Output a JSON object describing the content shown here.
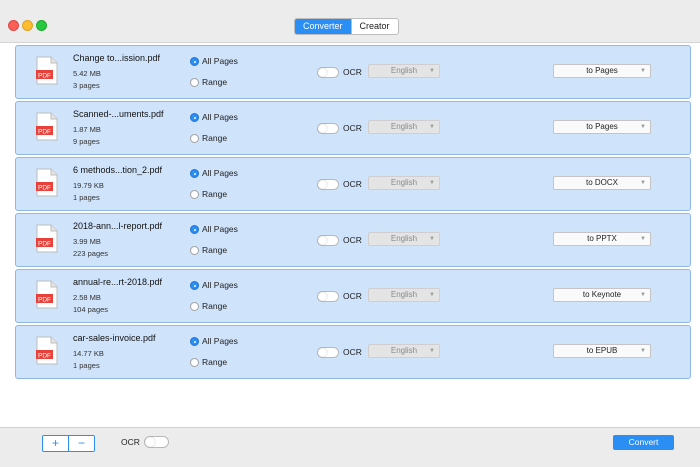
{
  "window": {
    "tabs": [
      {
        "label": "Converter",
        "active": true
      },
      {
        "label": "Creator",
        "active": false
      }
    ]
  },
  "files": [
    {
      "name": "Change to...ission.pdf",
      "size": "5.42 MB",
      "pages": "3 pages",
      "page_mode": "All Pages",
      "ocr": false,
      "language": "English",
      "target": "to Pages"
    },
    {
      "name": "Scanned-...uments.pdf",
      "size": "1.87 MB",
      "pages": "9 pages",
      "page_mode": "All Pages",
      "ocr": false,
      "language": "English",
      "target": "to Pages"
    },
    {
      "name": "6 methods...tion_2.pdf",
      "size": "19.79 KB",
      "pages": "1 pages",
      "page_mode": "All Pages",
      "ocr": false,
      "language": "English",
      "target": "to DOCX"
    },
    {
      "name": "2018-ann...l-report.pdf",
      "size": "3.99 MB",
      "pages": "223 pages",
      "page_mode": "All Pages",
      "ocr": false,
      "language": "English",
      "target": "to PPTX"
    },
    {
      "name": "annual-re...rt-2018.pdf",
      "size": "2.58 MB",
      "pages": "104 pages",
      "page_mode": "All Pages",
      "ocr": false,
      "language": "English",
      "target": "to Keynote"
    },
    {
      "name": "car-sales-invoice.pdf",
      "size": "14.77 KB",
      "pages": "1 pages",
      "page_mode": "All Pages",
      "ocr": false,
      "language": "English",
      "target": "to EPUB"
    }
  ],
  "labels": {
    "all_pages": "All Pages",
    "range": "Range",
    "ocr": "OCR",
    "pdf_badge": "PDF"
  },
  "bottom": {
    "add": "+",
    "remove": "−",
    "ocr_label": "OCR",
    "ocr_on": false,
    "convert": "Convert"
  },
  "colors": {
    "accent": "#2a8ef5",
    "row_bg": "#cfe3fb",
    "pdf_red": "#e8413a"
  },
  "icons": [
    "pdf-file-icon",
    "chevron-down-icon"
  ]
}
